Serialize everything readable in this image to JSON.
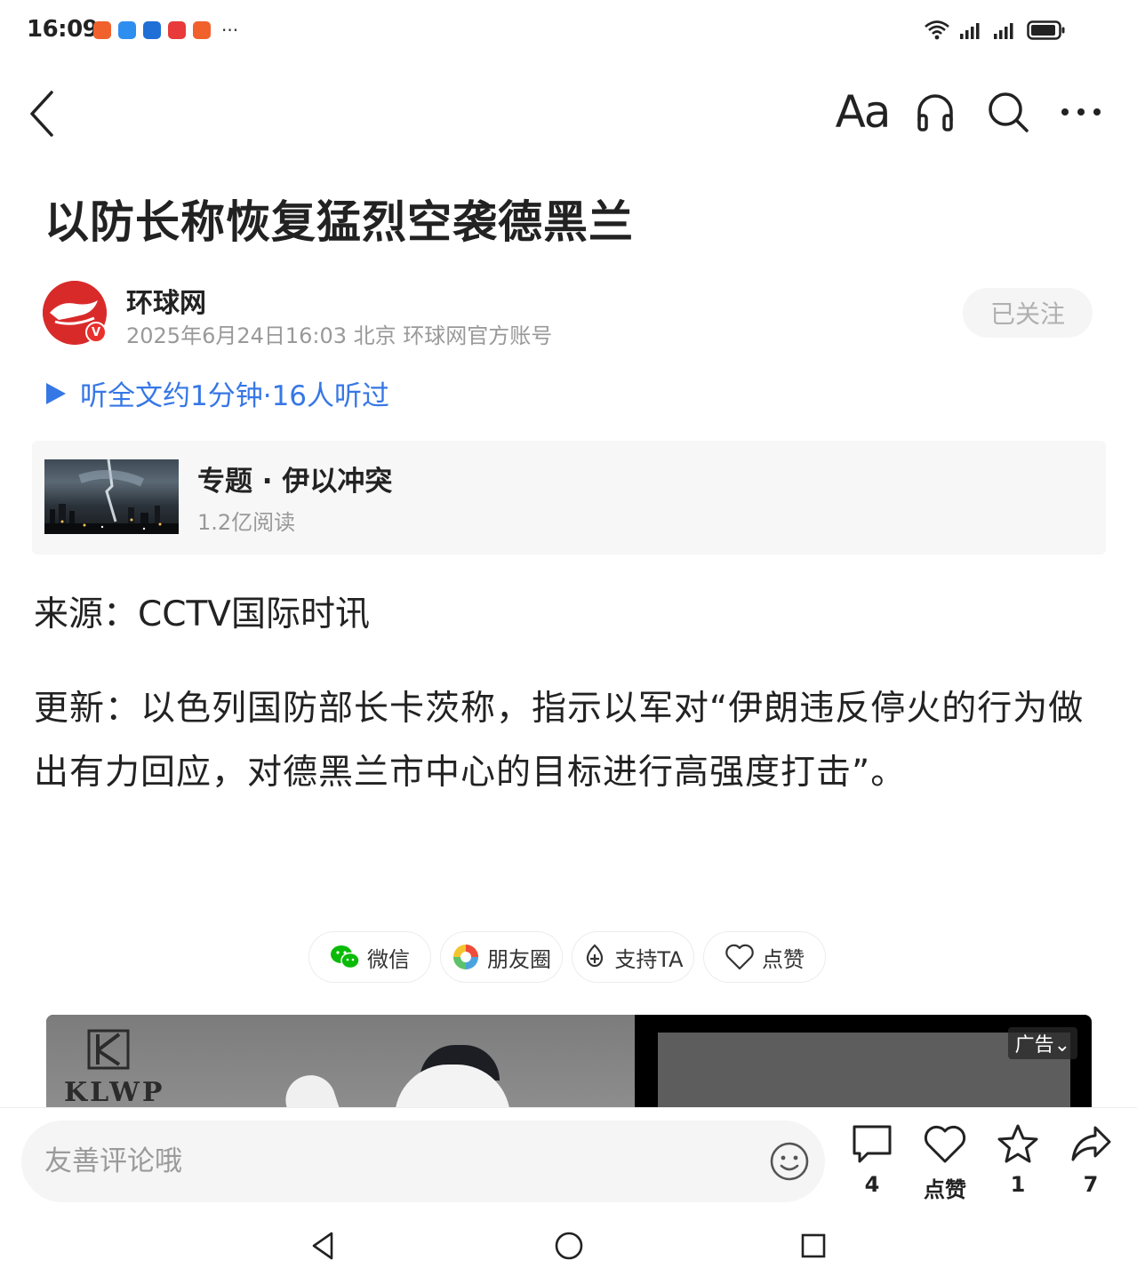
{
  "status_bar": {
    "time": "16:09",
    "notifications": [
      "#f0612c",
      "#2d8ef0",
      "#1f6fd6",
      "#e83a3a",
      "#f0612c"
    ],
    "more": "···"
  },
  "nav": {
    "font_label": "Aa"
  },
  "article": {
    "title": "以防长称恢复猛烈空袭德黑兰",
    "author": {
      "name": "环球网",
      "meta": "2025年6月24日16:03 北京 环球网官方账号",
      "verified_mark": "V",
      "follow_label": "已关注"
    },
    "listen_label": "听全文约1分钟·16人听过",
    "topic": {
      "title": "专题 · 伊以冲突",
      "reads": "1.2亿阅读"
    },
    "source": "来源：CCTV国际时讯",
    "paragraph": "更新：以色列国防部长卡茨称，指示以军对“伊朗违反停火的行为做出有力回应，对德黑兰市中心的目标进行高强度打击”。"
  },
  "share": {
    "wechat": "微信",
    "moments": "朋友圈",
    "support": "支持TA",
    "like": "点赞"
  },
  "ad": {
    "brand": "KLWP",
    "badge": "广告⌄"
  },
  "bottom_bar": {
    "comment_placeholder": "友善评论哦",
    "comments_count": "4",
    "like_label": "点赞",
    "favorites_count": "1",
    "shares_count": "7"
  },
  "colors": {
    "accent_blue": "#3677e6",
    "wechat_green": "#09bb07",
    "brand_red": "#d92a2a"
  }
}
